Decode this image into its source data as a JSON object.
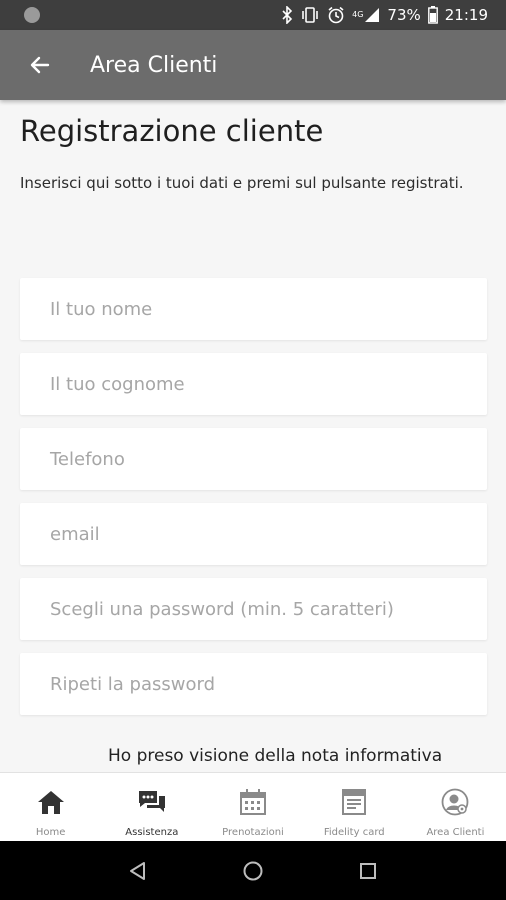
{
  "status_bar": {
    "battery": "73%",
    "time": "21:19",
    "network": "4G"
  },
  "app_bar": {
    "title": "Area Clienti"
  },
  "page": {
    "title": "Registrazione cliente",
    "intro": "Inserisci qui sotto i tuoi dati e premi sul pulsante registrati."
  },
  "form": {
    "fields": [
      {
        "placeholder": "Il tuo nome",
        "value": ""
      },
      {
        "placeholder": "Il tuo cognome",
        "value": ""
      },
      {
        "placeholder": "Telefono",
        "value": ""
      },
      {
        "placeholder": "email",
        "value": ""
      },
      {
        "placeholder": "Scegli una password (min. 5 caratteri)",
        "value": ""
      },
      {
        "placeholder": "Ripeti la password",
        "value": ""
      }
    ],
    "privacy_text": "Ho preso visione della nota informativa"
  },
  "bottom_nav": {
    "items": [
      {
        "label": "Home",
        "icon": "home-icon"
      },
      {
        "label": "Assistenza",
        "icon": "chat-icon",
        "active": true
      },
      {
        "label": "Prenotazioni",
        "icon": "calendar-icon"
      },
      {
        "label": "Fidelity card",
        "icon": "card-icon"
      },
      {
        "label": "Area Clienti",
        "icon": "user-icon"
      }
    ]
  },
  "colors": {
    "app_bar": "#6c6c6c",
    "status_bar": "#3e3e3e",
    "background": "#f6f6f6",
    "placeholder": "#a6a6a6"
  }
}
